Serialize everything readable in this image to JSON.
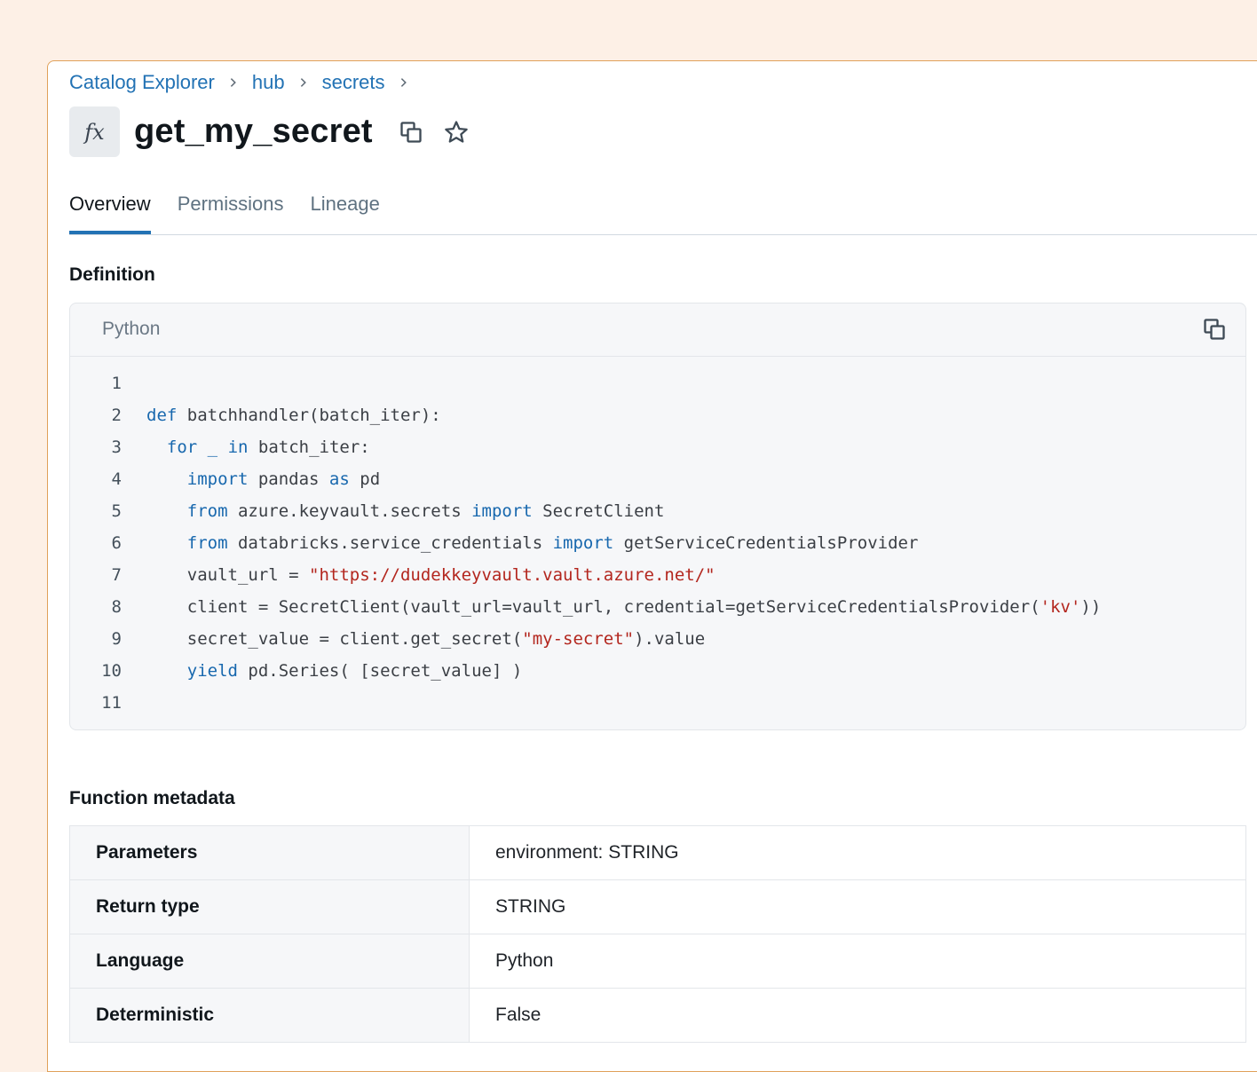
{
  "breadcrumb": {
    "items": [
      "Catalog Explorer",
      "hub",
      "secrets"
    ]
  },
  "header": {
    "icon_label": "fx",
    "title": "get_my_secret"
  },
  "tabs": [
    {
      "label": "Overview",
      "active": true
    },
    {
      "label": "Permissions",
      "active": false
    },
    {
      "label": "Lineage",
      "active": false
    }
  ],
  "definition": {
    "title": "Definition",
    "language": "Python",
    "lines": [
      {
        "n": "1",
        "tokens": []
      },
      {
        "n": "2",
        "tokens": [
          [
            "kw",
            "def"
          ],
          [
            "t",
            " batchhandler(batch_iter):"
          ]
        ]
      },
      {
        "n": "3",
        "tokens": [
          [
            "t",
            "  "
          ],
          [
            "kw",
            "for"
          ],
          [
            "t",
            " "
          ],
          [
            "kw",
            "_"
          ],
          [
            "t",
            " "
          ],
          [
            "kw",
            "in"
          ],
          [
            "t",
            " batch_iter:"
          ]
        ]
      },
      {
        "n": "4",
        "tokens": [
          [
            "t",
            "    "
          ],
          [
            "kw",
            "import"
          ],
          [
            "t",
            " pandas "
          ],
          [
            "kw",
            "as"
          ],
          [
            "t",
            " pd"
          ]
        ]
      },
      {
        "n": "5",
        "tokens": [
          [
            "t",
            "    "
          ],
          [
            "kw",
            "from"
          ],
          [
            "t",
            " azure.keyvault.secrets "
          ],
          [
            "kw",
            "import"
          ],
          [
            "t",
            " SecretClient"
          ]
        ]
      },
      {
        "n": "6",
        "tokens": [
          [
            "t",
            "    "
          ],
          [
            "kw",
            "from"
          ],
          [
            "t",
            " databricks.service_credentials "
          ],
          [
            "kw",
            "import"
          ],
          [
            "t",
            " getServiceCredentialsProvider"
          ]
        ]
      },
      {
        "n": "7",
        "tokens": [
          [
            "t",
            "    vault_url = "
          ],
          [
            "str",
            "\"https://dudekkeyvault.vault.azure.net/\""
          ]
        ]
      },
      {
        "n": "8",
        "tokens": [
          [
            "t",
            "    client = SecretClient(vault_url=vault_url, credential=getServiceCredentialsProvider("
          ],
          [
            "str",
            "'kv'"
          ],
          [
            "t",
            "))"
          ]
        ]
      },
      {
        "n": "9",
        "tokens": [
          [
            "t",
            "    secret_value = client.get_secret("
          ],
          [
            "str",
            "\"my-secret\""
          ],
          [
            "t",
            ").value"
          ]
        ]
      },
      {
        "n": "10",
        "tokens": [
          [
            "t",
            "    "
          ],
          [
            "kw",
            "yield"
          ],
          [
            "t",
            " pd.Series( [secret_value] )"
          ]
        ]
      },
      {
        "n": "11",
        "tokens": []
      }
    ]
  },
  "metadata": {
    "title": "Function metadata",
    "rows": [
      {
        "key": "Parameters",
        "value": "environment: STRING"
      },
      {
        "key": "Return type",
        "value": "STRING"
      },
      {
        "key": "Language",
        "value": "Python"
      },
      {
        "key": "Deterministic",
        "value": "False"
      }
    ]
  },
  "colors": {
    "accent": "#2272b4",
    "keyword": "#1868ae",
    "string": "#b3261e",
    "page_bg": "#fdf0e6",
    "panel_border": "#e0a15a"
  },
  "icons": [
    "chevron-right-icon",
    "function-icon",
    "copy-icon",
    "star-icon"
  ]
}
